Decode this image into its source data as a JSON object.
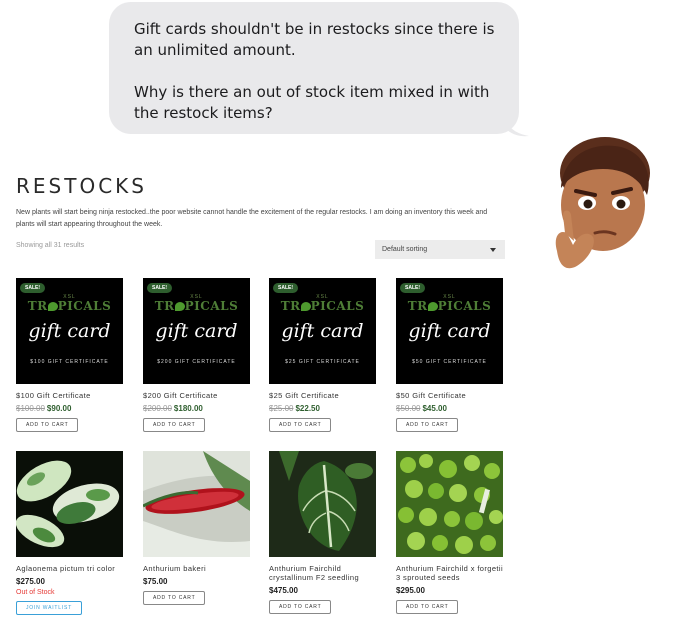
{
  "message": {
    "line1": "Gift cards shouldn't be in restocks since there is an unlimited amount.",
    "line2": "Why is there an out of stock item mixed in with the restock items?"
  },
  "page": {
    "title": "RESTOCKS",
    "description": "New plants will start being ninja restocked..the poor website cannot handle the excitement of the regular restocks. I am doing an inventory this week and plants will start appearing throughout the week.",
    "result_count": "Showing all 31 results",
    "sort_label": "Default sorting"
  },
  "gift_card": {
    "sale_badge": "SALE!",
    "logo_top": "XSL",
    "logo_left": "TR",
    "logo_right": "PICALS",
    "script": "gift card"
  },
  "products": [
    {
      "name": "$100 Gift Certificate",
      "old_price": "$100.00",
      "price": "$90.00",
      "cert_text": "$100 GIFT CERTIFICATE",
      "button": "ADD TO CART"
    },
    {
      "name": "$200 Gift Certificate",
      "old_price": "$200.00",
      "price": "$180.00",
      "cert_text": "$200 GIFT CERTIFICATE",
      "button": "ADD TO CART"
    },
    {
      "name": "$25 Gift Certificate",
      "old_price": "$25.00",
      "price": "$22.50",
      "cert_text": "$25 GIFT CERTIFICATE",
      "button": "ADD TO CART"
    },
    {
      "name": "$50 Gift Certificate",
      "old_price": "$50.00",
      "price": "$45.00",
      "cert_text": "$50 GIFT CERTIFICATE",
      "button": "ADD TO CART"
    },
    {
      "name": "Aglaonema pictum tri color",
      "price": "$275.00",
      "stock": "Out of Stock",
      "button": "JOIN WAITLIST"
    },
    {
      "name": "Anthurium bakeri",
      "price": "$75.00",
      "button": "ADD TO CART"
    },
    {
      "name": "Anthurium Fairchild crystallinum F2 seedling",
      "price": "$475.00",
      "button": "ADD TO CART"
    },
    {
      "name": "Anthurium Fairchild x forgetii 3 sprouted seeds",
      "price": "$295.00",
      "button": "ADD TO CART"
    }
  ]
}
